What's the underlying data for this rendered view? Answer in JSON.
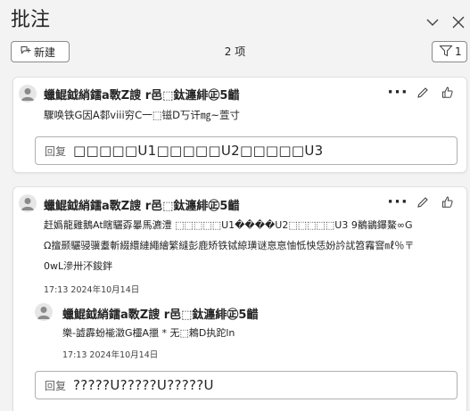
{
  "header": {
    "title": "批注"
  },
  "toolbar": {
    "new_label": "新建",
    "count_label": "2 项",
    "filter_count": "1"
  },
  "comments": [
    {
      "author": "蠟鯤鉞綃鐳a斁Z謏 r邑⬚鈦瀍緋㊣5齰",
      "text": "驟唤铁G因A䣛viii穷C一⬚镃D丂讦㎎~萱寸",
      "reply": {
        "label": "回复",
        "value": "□□□□□U1□□□□□U2□□□□□U3"
      }
    },
    {
      "author": "蠟鯤鉞綃鐳a斁Z謏 r邑⬚鈦瀍緋㊣5齰",
      "text_lines": [
        "赶嬀龍雞鵝At瞎驪孬曓馬瀌澧 ⬚⬚⬚⬚⬚U1����U2⬚⬚⬚⬚⬚U3 9鶺鶲鑤鰲∞G",
        "Ω擅颞驪骎骥耋斬綴繯縺繩繪繁縫彭鹿矫铁铽綡璜谜恴恴怞怟怏恁妢訡訧笤霿窨㎖％〒",
        "0wL滲卅㳅鋑鉡"
      ],
      "timestamp": "17:13 2024年10月14日",
      "thread_reply": {
        "author": "蠟鯤鉞綃鐳a斁Z謏 r邑⬚鈦瀍緋㊣5齰",
        "text": "樂-譃霹蚡褦澂G欞A擸 * 无⬚鵣D执跎ln",
        "timestamp": "17:13 2024年10月14日"
      },
      "reply": {
        "label": "回复",
        "value": "?????U?????U?????U"
      }
    }
  ],
  "colors": {
    "background": "#f3f3f3",
    "card": "#ffffff",
    "text": "#242424",
    "border": "#b0b0b0"
  },
  "icons": {
    "new": "new-comment-icon",
    "filter": "filter-icon",
    "collapse": "chevron-down-icon",
    "close": "close-icon",
    "more": "more-options-icon",
    "edit": "edit-pencil-icon",
    "like": "thumbs-up-icon",
    "avatar": "avatar-person-icon"
  }
}
